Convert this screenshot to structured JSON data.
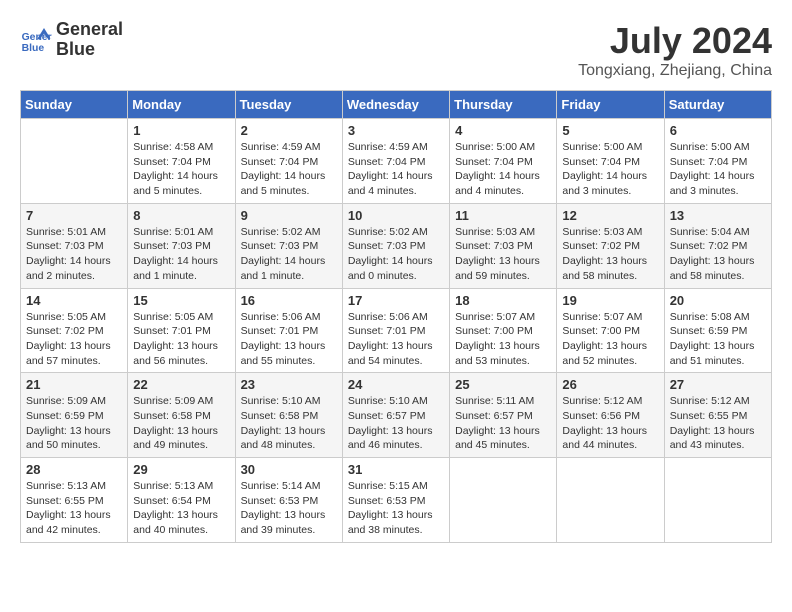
{
  "header": {
    "logo_line1": "General",
    "logo_line2": "Blue",
    "month_year": "July 2024",
    "location": "Tongxiang, Zhejiang, China"
  },
  "days_of_week": [
    "Sunday",
    "Monday",
    "Tuesday",
    "Wednesday",
    "Thursday",
    "Friday",
    "Saturday"
  ],
  "weeks": [
    [
      {
        "day": "",
        "info": ""
      },
      {
        "day": "1",
        "info": "Sunrise: 4:58 AM\nSunset: 7:04 PM\nDaylight: 14 hours\nand 5 minutes."
      },
      {
        "day": "2",
        "info": "Sunrise: 4:59 AM\nSunset: 7:04 PM\nDaylight: 14 hours\nand 5 minutes."
      },
      {
        "day": "3",
        "info": "Sunrise: 4:59 AM\nSunset: 7:04 PM\nDaylight: 14 hours\nand 4 minutes."
      },
      {
        "day": "4",
        "info": "Sunrise: 5:00 AM\nSunset: 7:04 PM\nDaylight: 14 hours\nand 4 minutes."
      },
      {
        "day": "5",
        "info": "Sunrise: 5:00 AM\nSunset: 7:04 PM\nDaylight: 14 hours\nand 3 minutes."
      },
      {
        "day": "6",
        "info": "Sunrise: 5:00 AM\nSunset: 7:04 PM\nDaylight: 14 hours\nand 3 minutes."
      }
    ],
    [
      {
        "day": "7",
        "info": "Sunrise: 5:01 AM\nSunset: 7:03 PM\nDaylight: 14 hours\nand 2 minutes."
      },
      {
        "day": "8",
        "info": "Sunrise: 5:01 AM\nSunset: 7:03 PM\nDaylight: 14 hours\nand 1 minute."
      },
      {
        "day": "9",
        "info": "Sunrise: 5:02 AM\nSunset: 7:03 PM\nDaylight: 14 hours\nand 1 minute."
      },
      {
        "day": "10",
        "info": "Sunrise: 5:02 AM\nSunset: 7:03 PM\nDaylight: 14 hours\nand 0 minutes."
      },
      {
        "day": "11",
        "info": "Sunrise: 5:03 AM\nSunset: 7:03 PM\nDaylight: 13 hours\nand 59 minutes."
      },
      {
        "day": "12",
        "info": "Sunrise: 5:03 AM\nSunset: 7:02 PM\nDaylight: 13 hours\nand 58 minutes."
      },
      {
        "day": "13",
        "info": "Sunrise: 5:04 AM\nSunset: 7:02 PM\nDaylight: 13 hours\nand 58 minutes."
      }
    ],
    [
      {
        "day": "14",
        "info": "Sunrise: 5:05 AM\nSunset: 7:02 PM\nDaylight: 13 hours\nand 57 minutes."
      },
      {
        "day": "15",
        "info": "Sunrise: 5:05 AM\nSunset: 7:01 PM\nDaylight: 13 hours\nand 56 minutes."
      },
      {
        "day": "16",
        "info": "Sunrise: 5:06 AM\nSunset: 7:01 PM\nDaylight: 13 hours\nand 55 minutes."
      },
      {
        "day": "17",
        "info": "Sunrise: 5:06 AM\nSunset: 7:01 PM\nDaylight: 13 hours\nand 54 minutes."
      },
      {
        "day": "18",
        "info": "Sunrise: 5:07 AM\nSunset: 7:00 PM\nDaylight: 13 hours\nand 53 minutes."
      },
      {
        "day": "19",
        "info": "Sunrise: 5:07 AM\nSunset: 7:00 PM\nDaylight: 13 hours\nand 52 minutes."
      },
      {
        "day": "20",
        "info": "Sunrise: 5:08 AM\nSunset: 6:59 PM\nDaylight: 13 hours\nand 51 minutes."
      }
    ],
    [
      {
        "day": "21",
        "info": "Sunrise: 5:09 AM\nSunset: 6:59 PM\nDaylight: 13 hours\nand 50 minutes."
      },
      {
        "day": "22",
        "info": "Sunrise: 5:09 AM\nSunset: 6:58 PM\nDaylight: 13 hours\nand 49 minutes."
      },
      {
        "day": "23",
        "info": "Sunrise: 5:10 AM\nSunset: 6:58 PM\nDaylight: 13 hours\nand 48 minutes."
      },
      {
        "day": "24",
        "info": "Sunrise: 5:10 AM\nSunset: 6:57 PM\nDaylight: 13 hours\nand 46 minutes."
      },
      {
        "day": "25",
        "info": "Sunrise: 5:11 AM\nSunset: 6:57 PM\nDaylight: 13 hours\nand 45 minutes."
      },
      {
        "day": "26",
        "info": "Sunrise: 5:12 AM\nSunset: 6:56 PM\nDaylight: 13 hours\nand 44 minutes."
      },
      {
        "day": "27",
        "info": "Sunrise: 5:12 AM\nSunset: 6:55 PM\nDaylight: 13 hours\nand 43 minutes."
      }
    ],
    [
      {
        "day": "28",
        "info": "Sunrise: 5:13 AM\nSunset: 6:55 PM\nDaylight: 13 hours\nand 42 minutes."
      },
      {
        "day": "29",
        "info": "Sunrise: 5:13 AM\nSunset: 6:54 PM\nDaylight: 13 hours\nand 40 minutes."
      },
      {
        "day": "30",
        "info": "Sunrise: 5:14 AM\nSunset: 6:53 PM\nDaylight: 13 hours\nand 39 minutes."
      },
      {
        "day": "31",
        "info": "Sunrise: 5:15 AM\nSunset: 6:53 PM\nDaylight: 13 hours\nand 38 minutes."
      },
      {
        "day": "",
        "info": ""
      },
      {
        "day": "",
        "info": ""
      },
      {
        "day": "",
        "info": ""
      }
    ]
  ]
}
